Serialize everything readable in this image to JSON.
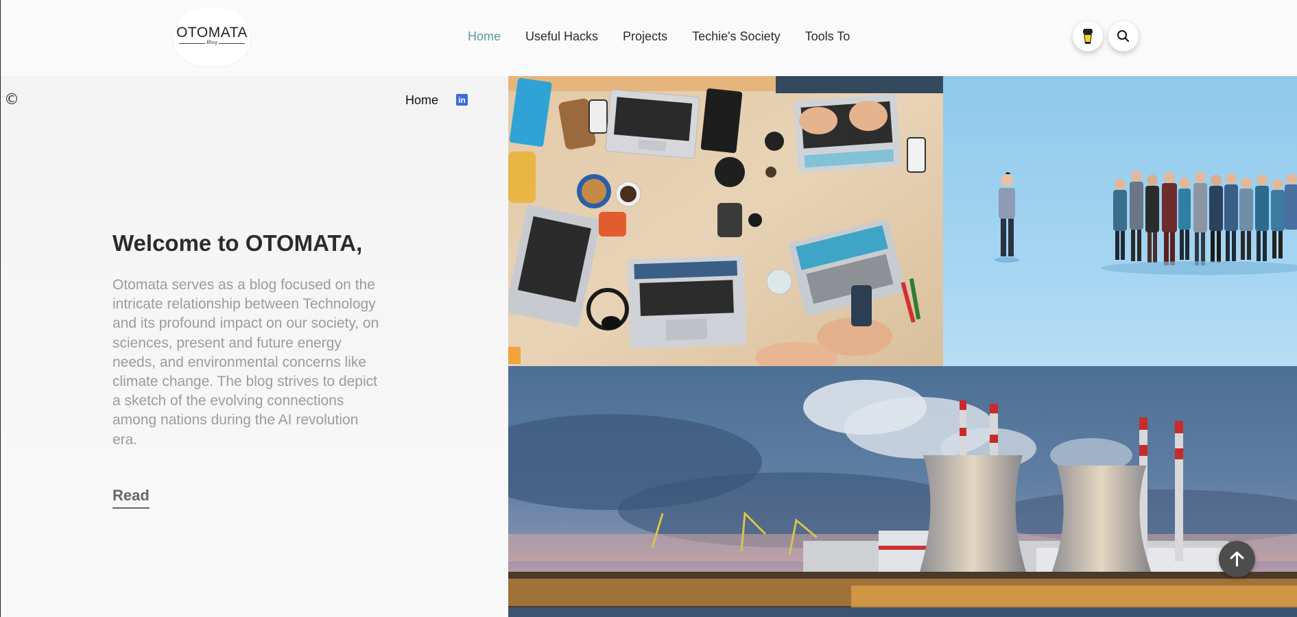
{
  "header": {
    "logo_text": "OTOMATA",
    "logo_sub": "Blog",
    "nav": [
      {
        "label": "Home",
        "active": true
      },
      {
        "label": "Useful Hacks",
        "active": false
      },
      {
        "label": "Projects",
        "active": false
      },
      {
        "label": "Techie's Society",
        "active": false
      },
      {
        "label": "Tools To",
        "active": false
      }
    ],
    "icons": [
      "coffee-cup-icon",
      "search-icon"
    ]
  },
  "left_panel": {
    "copyright_symbol": "©",
    "breadcrumb_home": "Home",
    "social_icon": "linkedin-icon",
    "social_letters": "in",
    "welcome_title": "Welcome to OTOMATA,",
    "description": "Otomata serves as a blog focused on the intricate relationship between Technology and its profound impact on our society, on sciences, present and future energy needs, and environmental concerns like climate change. The blog strives to depict a sketch of the evolving connections among nations during the AI revolution era.",
    "read_label": "Read"
  },
  "gallery": [
    {
      "name": "desk-laptops-photo"
    },
    {
      "name": "figurines-crowd-photo"
    },
    {
      "name": "power-plant-photo"
    }
  ],
  "colors": {
    "nav_active": "#5a9aa0",
    "linkedin": "#3b6ad9",
    "scroll_top_bg": "#4d4d4d"
  },
  "scroll_top_icon": "arrow-up-icon"
}
